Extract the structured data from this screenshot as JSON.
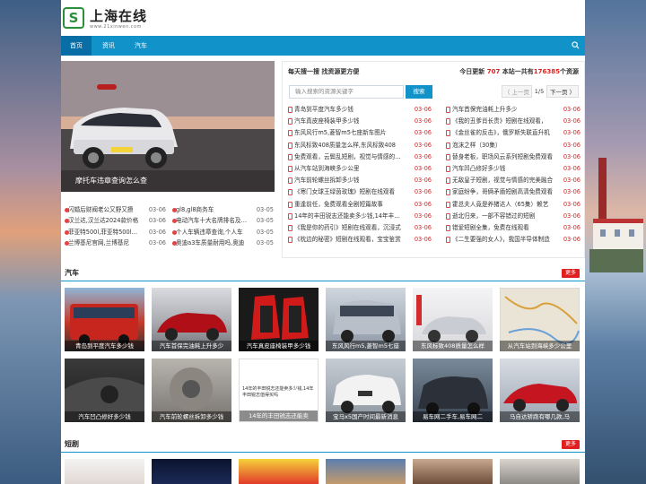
{
  "site": {
    "name": "上海在线",
    "url": "www.21xinwen.com",
    "logo_letter": "S"
  },
  "nav": {
    "items": [
      "首页",
      "资讯",
      "汽车"
    ]
  },
  "slider": {
    "caption": "摩托车违章查询怎么查"
  },
  "left_news": [
    [
      {
        "title": "闪婚后财阀老公又野又撩",
        "date": "03-06"
      },
      {
        "title": "汉兰达,汉兰达2024款价格",
        "date": "03-06"
      },
      {
        "title": "菲亚特500l,菲亚特500l报价",
        "date": "03-06"
      },
      {
        "title": "兰博基尼官网,兰博基尼",
        "date": "03-06"
      }
    ],
    [
      {
        "title": "gl8,gl8商务车",
        "date": "03-05"
      },
      {
        "title": "电动汽车十大名牌排名及价格",
        "date": "03-05"
      },
      {
        "title": "个人车辆违章查询,个人车",
        "date": "03-05"
      },
      {
        "title": "奥迪a3车质量耐用吗,奥迪",
        "date": "03-05"
      }
    ]
  ],
  "right_box": {
    "title": "每天搜一搜 找资源更方便",
    "stat_prefix": "今日更新",
    "stat_today": "707",
    "stat_mid": "本站一共有",
    "stat_total": "176385",
    "stat_suffix": "个资源",
    "search_placeholder": "输入搜索的资源关键字",
    "search_button": "搜索",
    "pager_prev": "〈 上一页",
    "pager_num": "1/5",
    "pager_next": "下一页 〉"
  },
  "right_lists": [
    [
      {
        "title": "青岛到平度汽车多少钱",
        "date": "03-06"
      },
      {
        "title": "汽车真皮座椅装甲多少钱",
        "date": "03-06"
      },
      {
        "title": "东风风行m5,菱智m5七座新车图片",
        "date": "03-06"
      },
      {
        "title": "东风标致408质量怎么样,东风标致408",
        "date": "03-06"
      },
      {
        "title": "免费观看，云鬓乱短剧，视觉与情感的双重",
        "date": "03-06"
      },
      {
        "title": "从汽车站到海峡多少公里",
        "date": "03-06"
      },
      {
        "title": "汽车前轮螺丝拆卸多少钱",
        "date": "03-06"
      },
      {
        "title": "《寒门女球王绿茵玫瑰》短剧在线观看",
        "date": "03-06"
      },
      {
        "title": "重逢前任，免费观看全剧短篇故事",
        "date": "03-06"
      },
      {
        "title": "14年的丰田锐志还能卖多少钱,14年丰田锐志",
        "date": "03-06"
      },
      {
        "title": "《我是你的药引》短剧在线观看，沉浸式",
        "date": "03-06"
      },
      {
        "title": "《枕边的秘密》短剧在线观看，宝宝鉴赏",
        "date": "03-06"
      }
    ],
    [
      {
        "title": "汽车首保完油耗上升多少",
        "date": "03-06"
      },
      {
        "title": "《我的丑爹肖长贵》短剧在线观看，",
        "date": "03-06"
      },
      {
        "title": "《金丝雀的反击》，俄罗斯失联直升机",
        "date": "03-06"
      },
      {
        "title": "泡沫之样（30集）",
        "date": "03-06"
      },
      {
        "title": "替身老板，职场风云系列短剧免费观看",
        "date": "03-06"
      },
      {
        "title": "汽车凹凸修好多少钱",
        "date": "03-06"
      },
      {
        "title": "无敌皇子短剧，视觉与情感的完美融合",
        "date": "03-06"
      },
      {
        "title": "家庭纷争，哥俩矛盾短剧高清免费观看",
        "date": "03-06"
      },
      {
        "title": "霍总夫人竟是养猪达人（65集）赖艺",
        "date": "03-06"
      },
      {
        "title": "逝北归来，一部不容错过的短剧",
        "date": "03-06"
      },
      {
        "title": "错爱短剧全集，免费在线观看",
        "date": "03-06"
      },
      {
        "title": "《二生要强的女人》，我国半导体制造",
        "date": "03-06"
      }
    ]
  ],
  "sections": [
    {
      "title": "汽车",
      "more": "更多",
      "cards": [
        "青岛到平度汽车多少钱",
        "汽车首保完油耗上升多少",
        "汽车真皮座椅装甲多少钱",
        "东风风行m5,菱智m5七座",
        "东风标致408质量怎么样",
        "从汽车站到海峡多少公里",
        "汽车凹凸修好多少钱",
        "汽车前轮螺丝拆卸多少钱",
        "14年的丰田锐志还能卖",
        "宝马x5国产时间最新消息",
        "易车网二手车,易车网二",
        "马自达轿跑有哪几款,马"
      ]
    },
    {
      "title": "短剧",
      "more": "更多"
    }
  ],
  "card_overlay_text": "14年的丰田锐志还能卖多少钱,14年丰田锐志值得买吗",
  "colors": {
    "accent": "#1192c8",
    "red": "#e02020",
    "logo_green": "#2a8f3b"
  }
}
